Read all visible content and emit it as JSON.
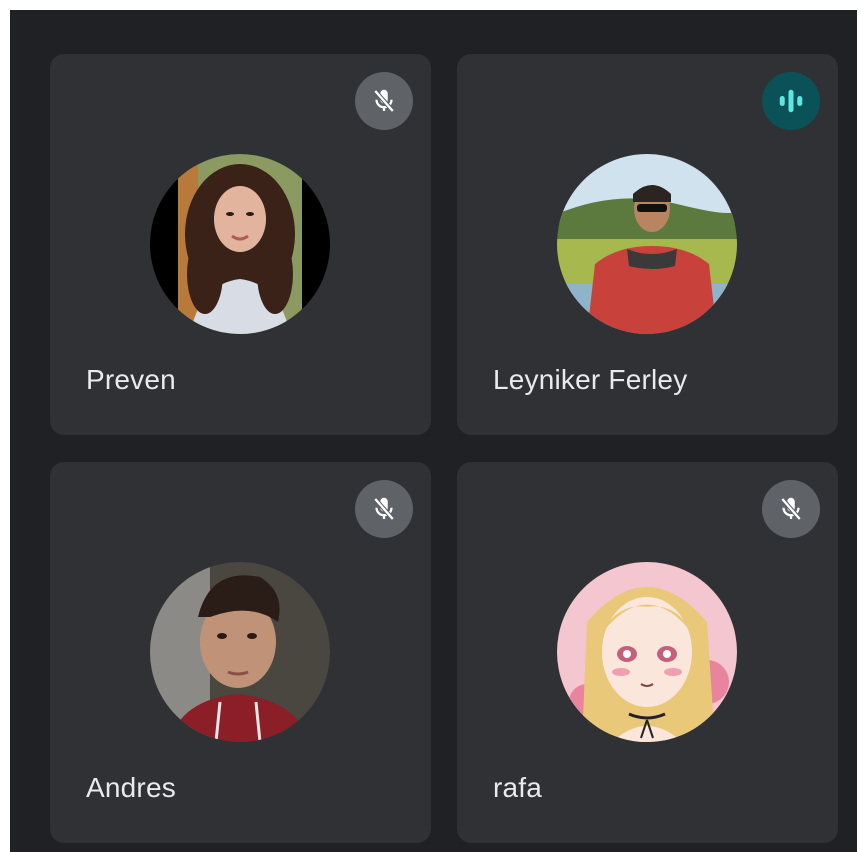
{
  "participants": [
    {
      "name": "Preven",
      "mic": "muted",
      "mic_icon": "mic-off-icon",
      "avatar": "woman-curly-hair-photo"
    },
    {
      "name": "Leyniker Ferley",
      "mic": "speaking",
      "mic_icon": "audio-level-icon",
      "avatar": "man-sunglasses-red-jacket-photo"
    },
    {
      "name": "Andres",
      "mic": "muted",
      "mic_icon": "mic-off-icon",
      "avatar": "young-man-selfie-photo"
    },
    {
      "name": "rafa",
      "mic": "muted",
      "mic_icon": "mic-off-icon",
      "avatar": "anime-girl-blonde-avatar"
    }
  ],
  "colors": {
    "background": "#202124",
    "tile": "#303134",
    "muted_badge": "#5f6368",
    "speaking_badge": "#0b5258",
    "speaking_bars": "#5ee6e2",
    "name_text": "#e8eaed"
  }
}
